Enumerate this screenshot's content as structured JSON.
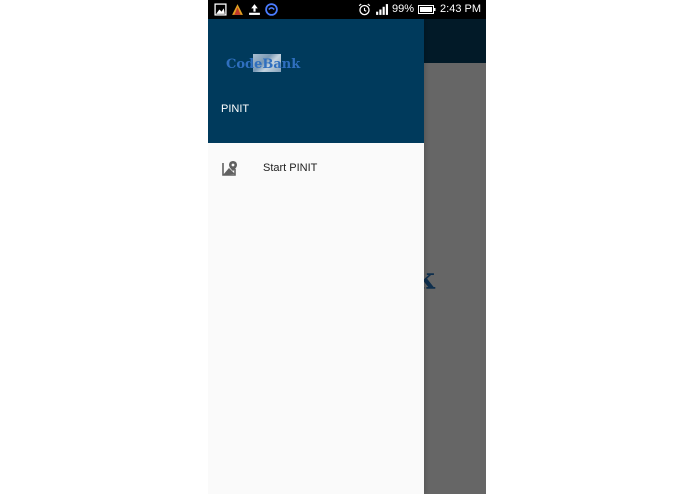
{
  "status_bar": {
    "battery": "99%",
    "time": "2:43 PM"
  },
  "app_background": {
    "partial_text": "k"
  },
  "drawer": {
    "header": {
      "logo_text": "CodeBank",
      "title": "PINIT"
    },
    "items": [
      {
        "label": "Start PINIT",
        "icon": "map-pin-icon"
      }
    ]
  },
  "colors": {
    "header": "#003a5c",
    "toolbar": "#021a28",
    "scrim": "#666666",
    "drawer_bg": "#fafafa"
  }
}
